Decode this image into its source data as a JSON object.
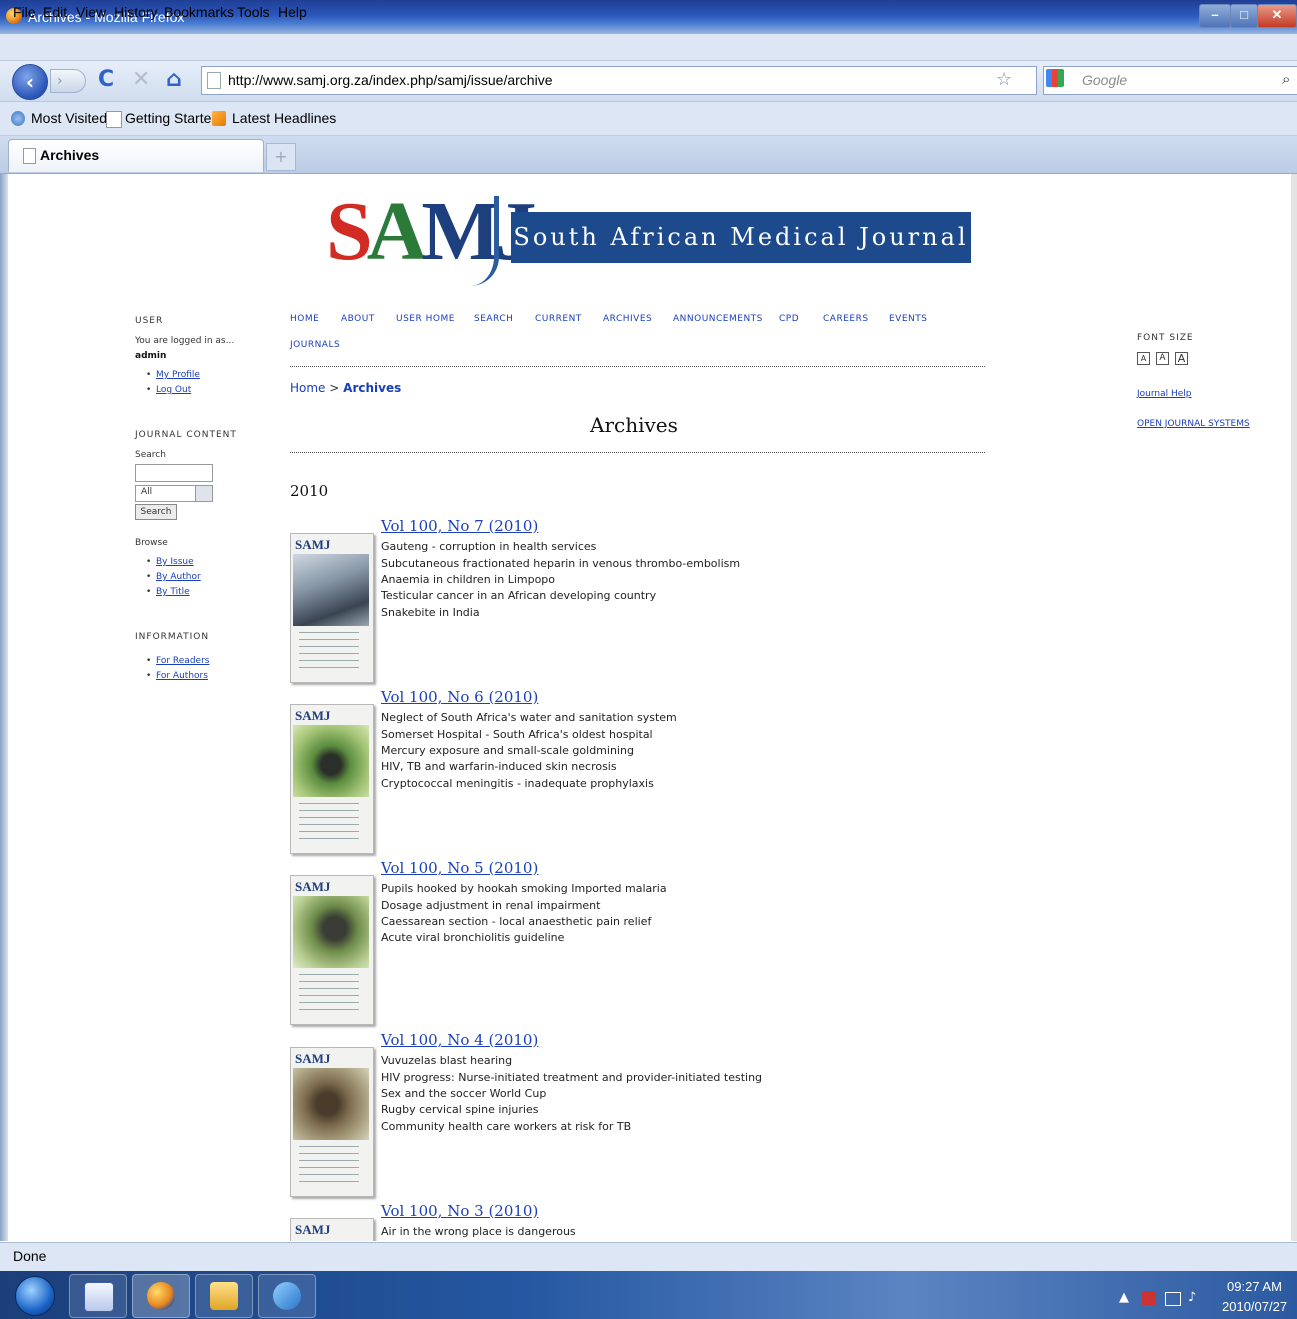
{
  "window": {
    "title": "Archives - Mozilla Firefox",
    "min": "–",
    "max": "□",
    "close": "✕"
  },
  "menu": [
    "File",
    "Edit",
    "View",
    "History",
    "Bookmarks",
    "Tools",
    "Help"
  ],
  "toolbar": {
    "url": "http://www.samj.org.za/index.php/samj/issue/archive",
    "search_placeholder": "Google",
    "back": "‹",
    "forward": "›",
    "reload": "C",
    "stop": "✕",
    "home": "⌂",
    "star": "☆",
    "magnifier": "⌕"
  },
  "bookmarks": [
    "Most Visited",
    "Getting Started",
    "Latest Headlines"
  ],
  "tabs": {
    "active_label": "Archives",
    "new_tab": "+"
  },
  "logo": {
    "samj_s": "S",
    "samj_a": "A",
    "samj_mj": "MJ",
    "banner": "South African Medical Journal"
  },
  "sidebar_left": {
    "user_heading": "USER",
    "logged_in_as": "You are logged in as...",
    "username": "admin",
    "user_links": [
      "My Profile",
      "Log Out"
    ],
    "journal_content_heading": "JOURNAL CONTENT",
    "search_label": "Search",
    "search_scope": "All",
    "search_button": "Search",
    "browse_label": "Browse",
    "browse_links": [
      "By Issue",
      "By Author",
      "By Title"
    ],
    "information_heading": "INFORMATION",
    "information_links": [
      "For Readers",
      "For Authors"
    ]
  },
  "nav": [
    "HOME",
    "ABOUT",
    "USER HOME",
    "SEARCH",
    "CURRENT",
    "ARCHIVES",
    "ANNOUNCEMENTS",
    "CPD",
    "CAREERS",
    "EVENTS",
    "JOURNALS"
  ],
  "breadcrumb": {
    "home": "Home",
    "separator": ">",
    "current": "Archives"
  },
  "page_title": "Archives",
  "year": "2010",
  "issues": [
    {
      "title": "Vol 100, No 7 (2010)",
      "lines": [
        "Gauteng - corruption in health services",
        "Subcutaneous fractionated heparin in venous thrombo-embolism",
        "Anaemia in children in Limpopo",
        "Testicular cancer in an African developing country",
        "Snakebite in India"
      ]
    },
    {
      "title": "Vol 100, No 6 (2010)",
      "lines": [
        "Neglect of South Africa's water and sanitation system",
        "Somerset Hospital - South Africa's oldest hospital",
        "Mercury exposure and small-scale goldmining",
        "HIV, TB and warfarin-induced skin necrosis",
        "Cryptococcal meningitis - inadequate prophylaxis"
      ]
    },
    {
      "title": "Vol 100, No 5 (2010)",
      "lines": [
        "Pupils hooked by hookah smoking Imported malaria",
        "Dosage adjustment in renal impairment",
        "Caessarean section - local anaesthetic pain relief",
        "Acute viral bronchiolitis guideline"
      ]
    },
    {
      "title": "Vol 100, No 4 (2010)",
      "lines": [
        "Vuvuzelas blast hearing",
        "HIV progress: Nurse-initiated treatment and provider-initiated testing",
        "Sex and the soccer World Cup",
        "Rugby cervical spine injuries",
        "Community health care workers at risk for TB"
      ]
    },
    {
      "title": "Vol 100, No 3 (2010)",
      "lines": [
        "Air in the wrong place is dangerous"
      ]
    }
  ],
  "cover_logo": "SAMJ",
  "sidebar_right": {
    "font_size_heading": "FONT SIZE",
    "font_sizes": [
      "A",
      "A",
      "A"
    ],
    "journal_help": "Journal Help",
    "ojs": "OPEN JOURNAL SYSTEMS"
  },
  "status": "Done",
  "clock": {
    "time": "09:27 AM",
    "date": "2010/07/27"
  },
  "colors": {
    "link": "#1a3fb8",
    "banner": "#1c4a8c",
    "logo_red": "#d22b23",
    "logo_green": "#2c7a3a"
  }
}
